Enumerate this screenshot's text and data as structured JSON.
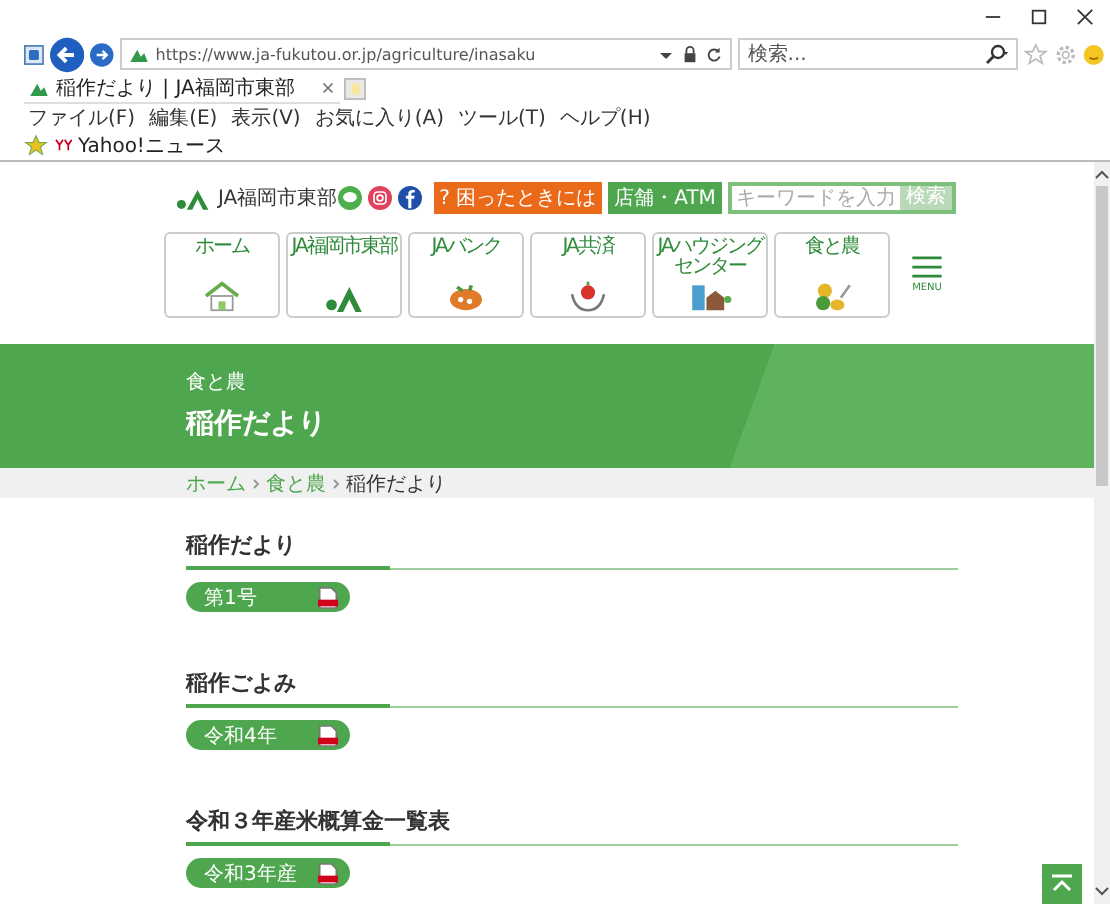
{
  "browser": {
    "url": "https://www.ja-fukutou.or.jp/agriculture/inasaku",
    "search_placeholder": "検索...",
    "tab_title": "稲作だより | JA福岡市東部",
    "menu": [
      "ファイル(F)",
      "編集(E)",
      "表示(V)",
      "お気に入り(A)",
      "ツール(T)",
      "ヘルプ(H)"
    ],
    "favorites": [
      "Yahoo!ニュース"
    ]
  },
  "header": {
    "site_name": "JA福岡市東部",
    "help_button": "? 困ったときには",
    "store_button": "店舗・ATM",
    "search_placeholder": "キーワードを入力",
    "search_button": "検索"
  },
  "nav": [
    {
      "label": "ホーム",
      "kind": "house"
    },
    {
      "label": "JA福岡市東部",
      "kind": "ja"
    },
    {
      "label": "JAバンク",
      "kind": "bank"
    },
    {
      "label": "JA共済",
      "kind": "kyosai"
    },
    {
      "label": "JAハウジングセンター",
      "kind": "housing"
    },
    {
      "label": "食と農",
      "kind": "food"
    }
  ],
  "menu_label": "MENU",
  "banner": {
    "category": "食と農",
    "title": "稲作だより"
  },
  "breadcrumb": [
    "ホーム",
    "食と農",
    "稲作だより"
  ],
  "sections": [
    {
      "title": "稲作だより",
      "button": "第1号"
    },
    {
      "title": "稲作ごよみ",
      "button": "令和4年"
    },
    {
      "title": "令和３年産米概算金一覧表",
      "button": "令和3年産"
    }
  ]
}
